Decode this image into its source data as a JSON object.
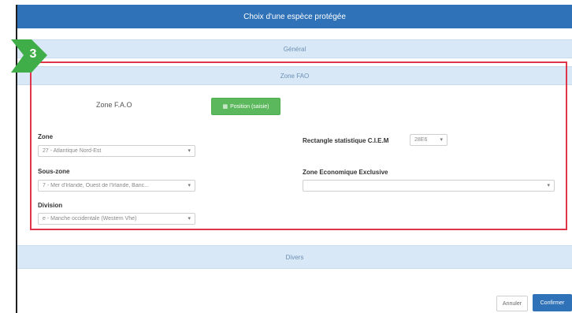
{
  "dialog": {
    "title": "Choix d'une espèce protégée"
  },
  "sections": {
    "general": "Général",
    "fao": "Zone FAO",
    "divers": "Divers"
  },
  "step_badge": {
    "number": "3",
    "color": "#3fae48"
  },
  "fao": {
    "zone_fao_label": "Zone F.A.O",
    "position_button": "Position (saisie)",
    "zone": {
      "label": "Zone",
      "value": "27 - Atlantique Nord-Est"
    },
    "sous_zone": {
      "label": "Sous-zone",
      "value": "7 - Mer d'Irlande, Ouest de l'Irlande, Banc..."
    },
    "division": {
      "label": "Division",
      "value": "e - Manche occidentale (Western Vhe)"
    },
    "rectangle": {
      "label": "Rectangle statistique C.I.E.M",
      "value": "28E6"
    },
    "zee": {
      "label": "Zone Economique Exclusive",
      "value": ""
    }
  },
  "footer": {
    "annuler": "Annuler",
    "confirmer": "Confirmer"
  },
  "colors": {
    "accent": "#2f72b8",
    "highlight": "#e0344b",
    "success": "#5cb85c"
  }
}
